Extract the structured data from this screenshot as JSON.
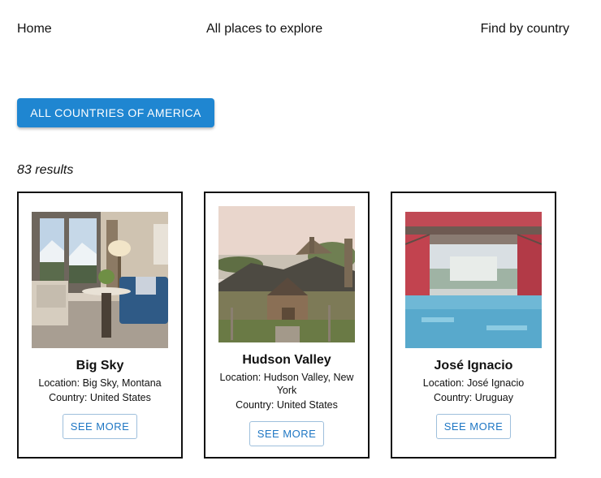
{
  "nav": {
    "home": "Home",
    "explore": "All places to explore",
    "find_country": "Find by country"
  },
  "filter_button": "ALL COUNTRIES OF AMERICA",
  "results_text": "83 results",
  "cards": [
    {
      "title": "Big Sky",
      "location": "Location: Big Sky, Montana",
      "country": "Country: United States",
      "button": "SEE MORE"
    },
    {
      "title": "Hudson Valley",
      "location": "Location: Hudson Valley, New York",
      "country": "Country: United States",
      "button": "SEE MORE"
    },
    {
      "title": "José Ignacio",
      "location": "Location: José Ignacio",
      "country": "Country: Uruguay",
      "button": "SEE MORE"
    }
  ],
  "colors": {
    "primary": "#1f86d1",
    "link": "#1f77c4",
    "border": "#111111"
  }
}
